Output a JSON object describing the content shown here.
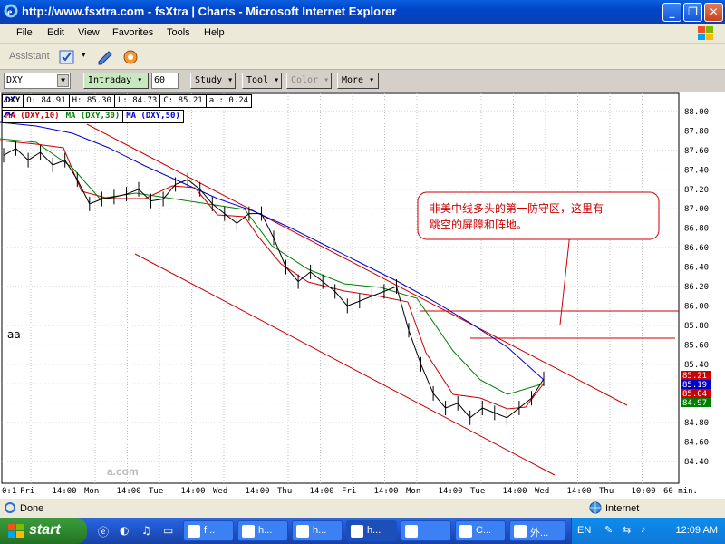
{
  "window": {
    "title": "http://www.fsxtra.com - fsXtra | Charts - Microsoft Internet Explorer",
    "minimize": "_",
    "maximize": "❐",
    "close": "✕"
  },
  "menu": {
    "items": [
      "File",
      "Edit",
      "View",
      "Favorites",
      "Tools",
      "Help"
    ]
  },
  "assistant": {
    "label": "Assistant"
  },
  "toolbar": {
    "symbol": "DXY",
    "interval": "Intraday",
    "minutes": "60",
    "study": "Study",
    "tool": "Tool",
    "color": "Color",
    "more": "More"
  },
  "quote": {
    "symbol": "DXY",
    "open": "O: 84.91",
    "high": "H: 85.30",
    "low": "L: 84.73",
    "close": "C: 85.21",
    "change": "a : 0.24"
  },
  "ma_legend": [
    "MA (DXY,10)",
    "MA (DXY,30)",
    "MA (DXY,50)"
  ],
  "annotation": {
    "line1": "非美中线多头的第一防守区，这里有",
    "line2": "跳空的屏障和阵地。"
  },
  "chart_label": "aa",
  "watermark": "a.com",
  "chart_data": {
    "type": "line",
    "y_ticks": [
      "88.00",
      "87.80",
      "87.60",
      "87.40",
      "87.20",
      "87.00",
      "86.80",
      "86.60",
      "86.40",
      "86.20",
      "86.00",
      "85.80",
      "85.60",
      "85.40",
      "85.20",
      "85.00",
      "84.80",
      "84.60",
      "84.40"
    ],
    "x_ticks": [
      "Fri",
      "14:00",
      "Mon",
      "14:00",
      "Tue",
      "14:00",
      "Wed",
      "14:00",
      "Thu",
      "14:00",
      "Fri",
      "14:00",
      "Mon",
      "14:00",
      "Tue",
      "14:00",
      "Wed",
      "14:00",
      "Thu",
      "10:00",
      "60 min."
    ],
    "x_first_label": "0:1",
    "ylim": [
      84.3,
      88.1
    ],
    "price_labels": [
      {
        "text": "85.21",
        "color": "#cc0000"
      },
      {
        "text": "85.19",
        "color": "#0000cc"
      },
      {
        "text": "85.04",
        "color": "#cc0000"
      },
      {
        "text": "84.97",
        "color": "#008000"
      }
    ],
    "series": [
      {
        "name": "DXY",
        "color": "#000000",
        "values": [
          87.55,
          87.62,
          87.5,
          87.58,
          87.45,
          87.5,
          87.3,
          87.05,
          87.1,
          87.12,
          87.15,
          87.2,
          87.08,
          87.1,
          87.25,
          87.3,
          87.2,
          87.05,
          86.95,
          86.85,
          86.95,
          86.95,
          86.7,
          86.4,
          86.25,
          86.35,
          86.25,
          86.15,
          86.0,
          86.05,
          86.1,
          86.15,
          86.2,
          85.75,
          85.4,
          85.1,
          84.95,
          85.0,
          84.85,
          84.95,
          84.9,
          84.85,
          84.95,
          85.05,
          85.25
        ]
      },
      {
        "name": "MA (DXY,10)",
        "color": "#cc0000",
        "values": []
      },
      {
        "name": "MA (DXY,30)",
        "color": "#008000",
        "values": []
      },
      {
        "name": "MA (DXY,50)",
        "color": "#0000cc",
        "values": []
      }
    ]
  },
  "status": {
    "text": "Done",
    "zone": "Internet"
  },
  "taskbar": {
    "start": "start",
    "tasks": [
      "f...",
      "h...",
      "h...",
      "h...",
      "",
      "C...",
      "外..."
    ],
    "lang": "EN",
    "time": "12:09 AM"
  }
}
